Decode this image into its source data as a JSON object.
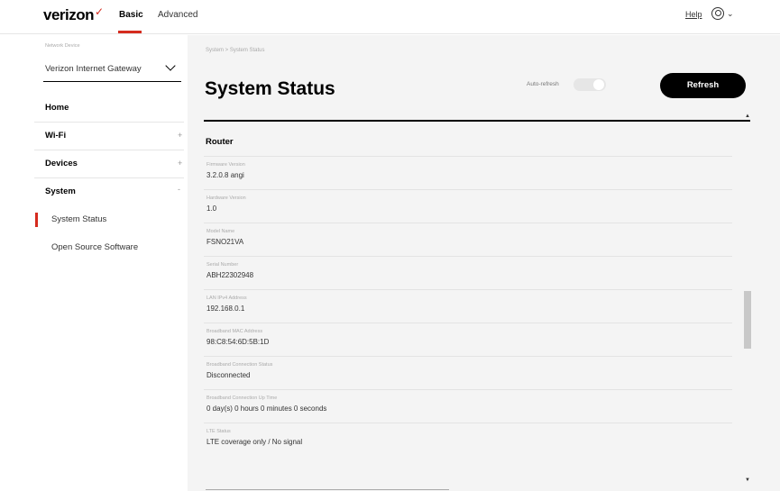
{
  "header": {
    "logo": "verizon",
    "tabs": [
      {
        "label": "Basic",
        "active": true
      },
      {
        "label": "Advanced",
        "active": false
      }
    ],
    "help_label": "Help",
    "user_icon": "user-circle-icon"
  },
  "sidebar": {
    "device_select": {
      "label": "Network Device",
      "value": "Verizon Internet Gateway"
    },
    "items": [
      {
        "label": "Home",
        "sign": ""
      },
      {
        "label": "Wi-Fi",
        "sign": "+"
      },
      {
        "label": "Devices",
        "sign": "+"
      },
      {
        "label": "System",
        "sign": "-"
      }
    ],
    "subitems": [
      {
        "label": "System Status",
        "active": true
      },
      {
        "label": "Open Source Software",
        "active": false
      }
    ]
  },
  "main": {
    "breadcrumb": "System > System Status",
    "title": "System Status",
    "autorefresh_label": "Auto-refresh",
    "autorefresh_on": false,
    "refresh_label": "Refresh",
    "section": "Router",
    "rows": [
      {
        "label": "Firmware Version",
        "value": "3.2.0.8 angi"
      },
      {
        "label": "Hardware Version",
        "value": "1.0"
      },
      {
        "label": "Model Name",
        "value": "FSNO21VA"
      },
      {
        "label": "Serial Number",
        "value": "ABH22302948"
      },
      {
        "label": "LAN IPv4 Address",
        "value": "192.168.0.1"
      },
      {
        "label": "Broadband MAC Address",
        "value": "98:C8:54:6D:5B:1D"
      },
      {
        "label": "Broadband Connection Status",
        "value": "Disconnected"
      },
      {
        "label": "Broadband Connection Up Time",
        "value": "0 day(s) 0 hours 0 minutes 0 seconds"
      },
      {
        "label": "LTE Status",
        "value": "LTE coverage only / No signal"
      }
    ]
  },
  "colors": {
    "accent": "#d52b1e",
    "main_bg": "#f4f4f4",
    "button_bg": "#000000"
  }
}
